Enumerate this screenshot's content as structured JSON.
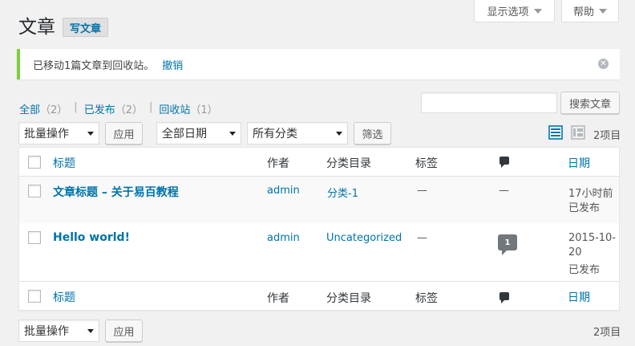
{
  "header": {
    "title": "文章",
    "add_new": "写文章",
    "screen_options": "显示选项",
    "help": "帮助"
  },
  "notice": {
    "message": "已移动1篇文章到回收站。",
    "undo": "撤销"
  },
  "views": {
    "all": "全部",
    "all_count": "（2）",
    "published": "已发布",
    "published_count": "（2）",
    "trash": "回收站",
    "trash_count": "（1）",
    "separator": "|"
  },
  "search": {
    "value": "",
    "button": "搜索文章"
  },
  "filters": {
    "bulk_action": "批量操作",
    "apply": "应用",
    "date": "全部日期",
    "category": "所有分类",
    "filter": "筛选",
    "items_count": "2项目"
  },
  "table": {
    "columns": {
      "title": "标题",
      "author": "作者",
      "categories": "分类目录",
      "tags": "标签",
      "date": "日期"
    },
    "rows": [
      {
        "title": "文章标题 – 关于易百教程",
        "author": "admin",
        "category": "分类-1",
        "tags": "—",
        "comments": "—",
        "date_line1": "17小时前",
        "date_line2": "已发布",
        "date_line3": ""
      },
      {
        "title": "Hello world!",
        "author": "admin",
        "category": "Uncategorized",
        "tags": "—",
        "comments": "1",
        "date_line1": "2015-10-",
        "date_line2": "20",
        "date_line3": "已发布"
      }
    ]
  },
  "bottom": {
    "bulk_action": "批量操作",
    "apply": "应用",
    "items_count": "2项目"
  },
  "icons": {
    "comments_header": "comment-bubble-icon",
    "list_view": "list-view-icon",
    "excerpt_view": "excerpt-view-icon",
    "dismiss": "dismiss-icon"
  },
  "colors": {
    "link": "#0073aa",
    "notice_success": "#7ad03a",
    "background": "#f1f1f1"
  }
}
